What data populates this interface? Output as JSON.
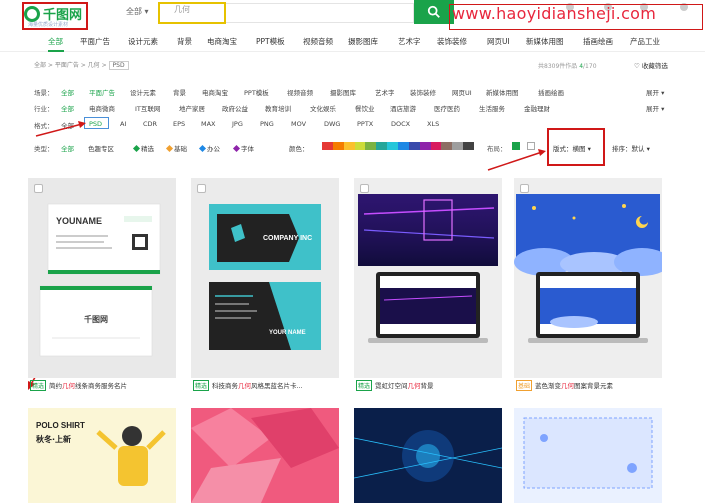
{
  "header": {
    "logo_text": "千图网",
    "slogan": "海量优质设计素材",
    "search_scope": "全部",
    "search_value": "几何",
    "watermark": "www.haoyidiansheji.com"
  },
  "nav": {
    "items": [
      "全部",
      "平面广告",
      "设计元素",
      "背景",
      "电商淘宝",
      "PPT模板",
      "视频音频",
      "摄影图库",
      "艺术字",
      "装饰装修",
      "网页UI",
      "新媒体用图",
      "插画绘画",
      "产品工业"
    ]
  },
  "breadcrumb": {
    "text": "全部 > 平面广告 > 几何 >",
    "tag": "PSD"
  },
  "stats": {
    "result_text": "共8309件作品",
    "page_current": "4",
    "page_total": "/170",
    "fav_text": "♡ 收藏筛选"
  },
  "filters": {
    "scene": {
      "label": "场景：",
      "items": [
        "全部",
        "平面广告",
        "设计元素",
        "背景",
        "电商淘宝",
        "PPT模板",
        "视频音频",
        "摄影图库",
        "艺术字",
        "装饰装修",
        "网页UI",
        "新媒体用图",
        "插画绘画"
      ],
      "active": 1,
      "expand": "展开 ▾"
    },
    "industry": {
      "label": "行业：",
      "items": [
        "全部",
        "电商微商",
        "IT互联网",
        "地产家居",
        "政府公益",
        "教育培训",
        "文化娱乐",
        "餐饮业",
        "酒店旅游",
        "医疗医药",
        "生活服务",
        "金融理财"
      ],
      "active": 0,
      "expand": "展开 ▾"
    },
    "format": {
      "label": "格式：",
      "items": [
        "全部",
        "PSD",
        "AI",
        "CDR",
        "EPS",
        "MAX",
        "JPG",
        "PNG",
        "MOV",
        "DWG",
        "PPTX",
        "DOCX",
        "XLS"
      ],
      "active": 1
    }
  },
  "typerow": {
    "label": "类型：",
    "all": "全部",
    "color_zone": "色趣专区",
    "featured": "精选",
    "basic": "基础",
    "office": "办公",
    "font": "字体",
    "color_label": "颜色：",
    "layout_label": "布局：",
    "style_label": "版式：横图",
    "sort_label": "排序：默认"
  },
  "colors": {
    "brand": "#1aa34a",
    "highlight_red": "#d01818",
    "highlight_yellow": "#e6c200",
    "keyword": "#e8273d",
    "palette": [
      "#e53935",
      "#f57c00",
      "#fbc02d",
      "#cddc39",
      "#7cb342",
      "#26a69a",
      "#26c6da",
      "#1e88e5",
      "#3949ab",
      "#8e24aa",
      "#d81b60",
      "#8d6e63",
      "#9e9e9e",
      "#424242"
    ]
  },
  "cards": [
    {
      "badge": "精选",
      "pre": "简约",
      "kw": "几何",
      "post": "线条商务服务名片",
      "thumb_text_a": "YOUNAME",
      "thumb_text_b": "千图网"
    },
    {
      "badge": "精选",
      "pre": "科技商务",
      "kw": "几何",
      "post": "风格黑蓝名片卡...",
      "thumb_text_a": "COMPANY INC",
      "thumb_text_b": "YOUR NAME"
    },
    {
      "badge": "精选",
      "pre": "霓虹灯空间",
      "kw": "几何",
      "post": "背景"
    },
    {
      "badge": "基础",
      "pre": "蓝色渐变",
      "kw": "几何",
      "post": "图案背景元素"
    }
  ],
  "bottom_cards": [
    {
      "text_a": "POLO SHIRT",
      "text_b": "秋冬·上新"
    }
  ],
  "icons": [
    "search-icon",
    "grid-view-icon",
    "list-view-icon",
    "heart-icon",
    "checkbox-icon",
    "diamond-icon"
  ]
}
